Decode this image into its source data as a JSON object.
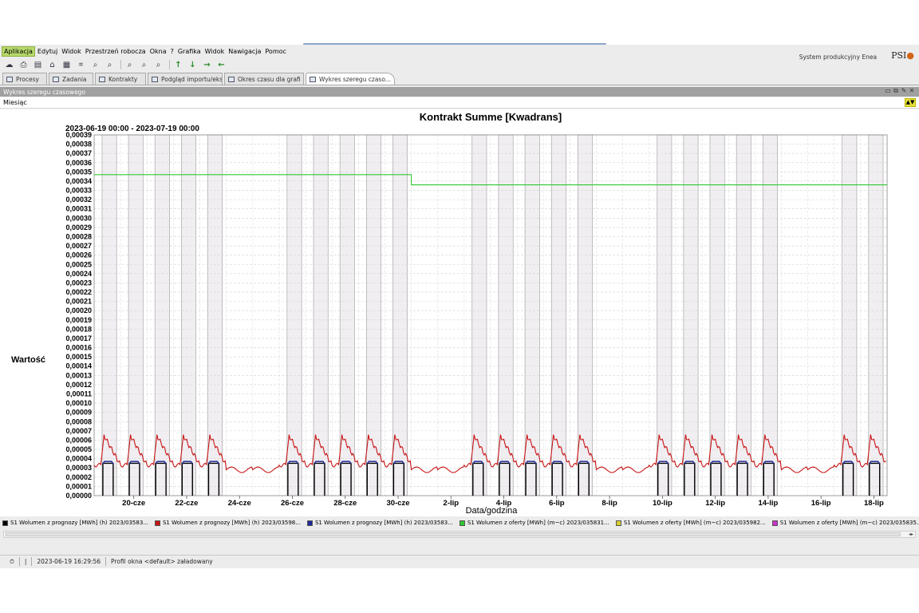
{
  "menu": {
    "items": [
      "Aplikacja",
      "Edytuj",
      "Widok",
      "Przestrzeń robocza",
      "Okna",
      "?",
      "Grafika",
      "Widok",
      "Nawigacja",
      "Pomoc"
    ],
    "active_index": 0
  },
  "brand": {
    "system_label": "System produkcyjny Enea",
    "logo": "PSI"
  },
  "toolbar": {
    "icons": [
      "cloud-icon",
      "print-icon",
      "save-icon",
      "home-icon",
      "grid-icon",
      "crop-icon",
      "zoom-icon",
      "zoom-icon",
      "zoom-icon",
      "zoom-icon",
      "zoom-icon"
    ],
    "arrows": [
      "↑",
      "↓",
      "→",
      "←"
    ]
  },
  "tabs": [
    {
      "label": "Procesy"
    },
    {
      "label": "Zadania"
    },
    {
      "label": "Kontrakty"
    },
    {
      "label": "Podgląd importu/eksp"
    },
    {
      "label": "Okres czasu dla grafi"
    },
    {
      "label": "Wykres szeregu czaso..."
    }
  ],
  "active_tab": 5,
  "panel": {
    "title": "Wykres szeregu czasowego"
  },
  "subbar": {
    "period": "Miesiąc",
    "btn_glyph": "▲▼"
  },
  "chart_data": {
    "type": "line",
    "title": "Kontrakt Summe [Kwadrans]",
    "subtitle": "2023-06-19 00:00 - 2023-07-19 00:00",
    "xlabel": "Data/godzina",
    "ylabel": "Wartość",
    "ylim": [
      0,
      0.00039
    ],
    "ytick_step": 1e-05,
    "x_start_day": 19,
    "x_end_day": 49,
    "x_tick_labels": [
      {
        "day": 20.5,
        "label": "20-cze"
      },
      {
        "day": 22.5,
        "label": "22-cze"
      },
      {
        "day": 24.5,
        "label": "24-cze"
      },
      {
        "day": 26.5,
        "label": "26-cze"
      },
      {
        "day": 28.5,
        "label": "28-cze"
      },
      {
        "day": 30.5,
        "label": "30-cze"
      },
      {
        "day": 32.5,
        "label": "2-lip"
      },
      {
        "day": 34.5,
        "label": "4-lip"
      },
      {
        "day": 36.5,
        "label": "6-lip"
      },
      {
        "day": 38.5,
        "label": "8-lip"
      },
      {
        "day": 40.5,
        "label": "10-lip"
      },
      {
        "day": 42.5,
        "label": "12-lip"
      },
      {
        "day": 44.5,
        "label": "14-lip"
      },
      {
        "day": 46.5,
        "label": "16-lip"
      },
      {
        "day": 48.5,
        "label": "18-lip"
      }
    ],
    "grid": true,
    "workdays": [
      19,
      20,
      21,
      22,
      23,
      26,
      27,
      28,
      29,
      30,
      33,
      34,
      35,
      36,
      37,
      40,
      41,
      42,
      43,
      44,
      47,
      48
    ],
    "series": [
      {
        "name": "S1 Wolumen z prognozy [MWh] (h) 2023/03583...",
        "color": "#000000",
        "legend_color": "#000000",
        "description": "work-hour blocks",
        "daily_work_value": 3.5e-05
      },
      {
        "name": "S1 Wolumen z prognozy [MWh] (h) 2023/03598...",
        "color": "#c81414",
        "legend_color": "#c81414",
        "weekday_peak": 6.5e-05,
        "weekday_min": 3.3e-05,
        "weekend_level": 2.8e-05
      },
      {
        "name": "S1 Wolumen z prognozy [MWh] (h) 2023/03583...",
        "color": "#1f2a9c",
        "legend_color": "#1f2a9c",
        "daily_work_value": 3.7e-05
      },
      {
        "name": "S1 Wolumen z oferty [MWh] (m~c) 2023/035831...",
        "color": "#2ec82e",
        "legend_color": "#2ec82e",
        "steps": [
          {
            "from": 19,
            "to": 31,
            "value": 0.000347
          },
          {
            "from": 31,
            "to": 49,
            "value": 0.000336
          }
        ]
      },
      {
        "name": "S1 Wolumen z oferty [MWh] (m~c) 2023/035982...",
        "color": "#d8d030",
        "legend_color": "#d8d030"
      },
      {
        "name": "S1 Wolumen z oferty [MWh] (m~c) 2023/035835...",
        "color": "#c832c8",
        "legend_color": "#c832c8"
      }
    ]
  },
  "status": {
    "timestamp": "2023-06-19 16:29:56",
    "message": "Profil okna <default> załadowany"
  }
}
